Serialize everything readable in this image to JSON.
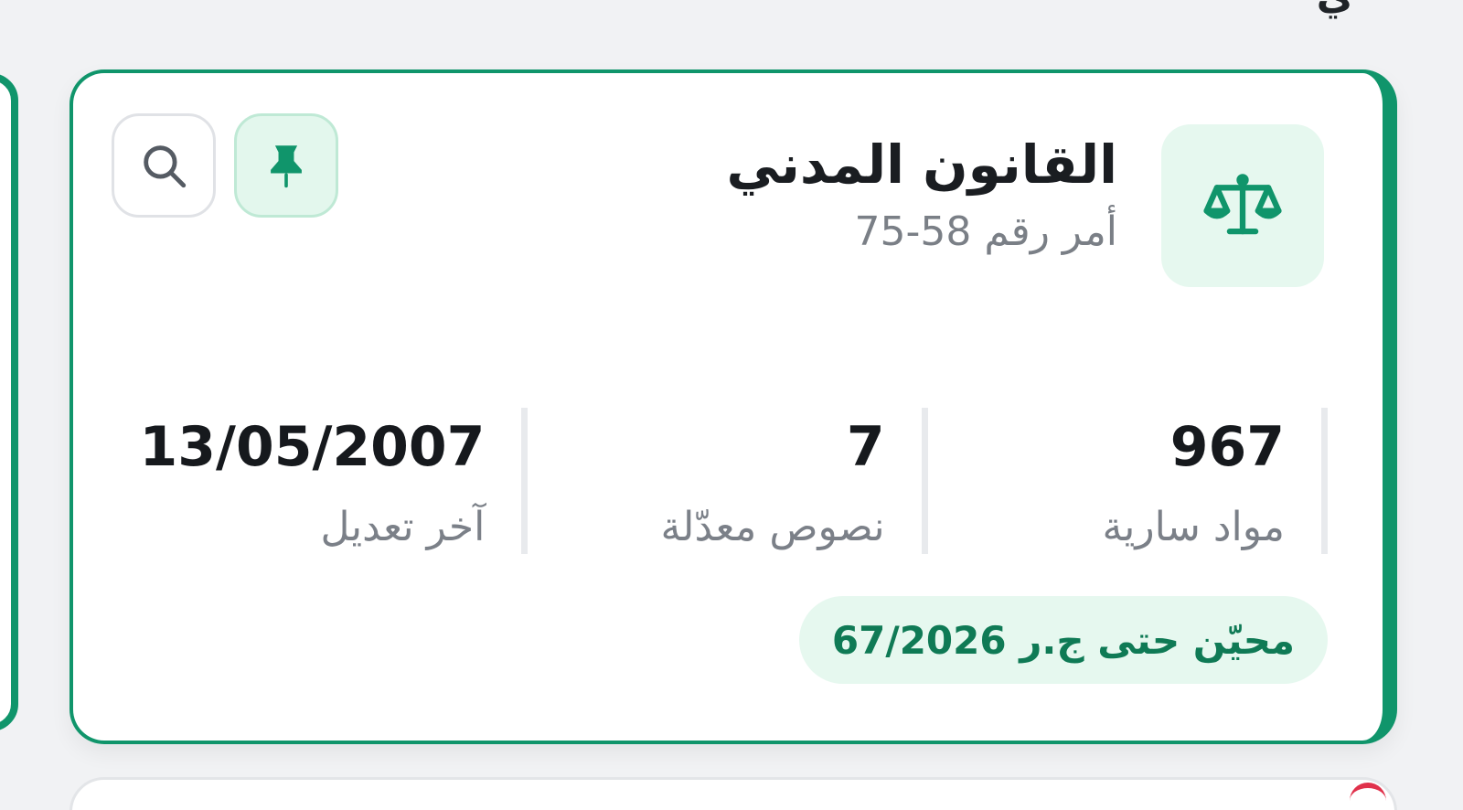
{
  "header": {
    "partial_title": "ي"
  },
  "law_card": {
    "title": "القانون المدني",
    "subtitle": "أمر رقم 58-75",
    "icon": "scales-icon",
    "actions": {
      "pin_icon": "pin-icon",
      "search_icon": "search-icon"
    },
    "stats": [
      {
        "value": "967",
        "label": "مواد سارية"
      },
      {
        "value": "7",
        "label": "نصوص معدّلة"
      },
      {
        "value": "13/05/2007",
        "label": "آخر تعديل"
      }
    ],
    "status": "محيّن حتى ج.ر 67/2026",
    "colors": {
      "accent": "#10956b",
      "accent_light": "#e6f8ef",
      "status_text": "#0f7a55"
    }
  }
}
